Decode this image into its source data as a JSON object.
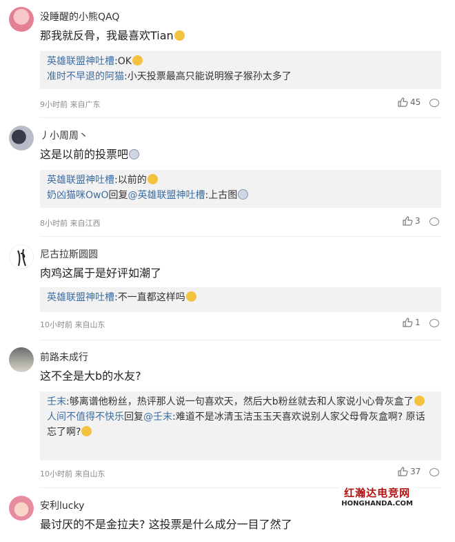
{
  "comments": [
    {
      "username": "没睡醒的小熊QAQ",
      "text": "那我就反骨，我最喜欢Tian",
      "replies": [
        {
          "author": "英雄联盟神吐槽",
          "content": ":OK"
        },
        {
          "author": "准时不早退的阿猫",
          "content": ":小天投票最高只能说明猴子猴孙太多了"
        }
      ],
      "meta": "9小时前 来自广东",
      "likes": "45"
    },
    {
      "username": "丿小周周丶",
      "text": "这是以前的投票吧",
      "replies": [
        {
          "author": "英雄联盟神吐槽",
          "content": ":以前的"
        },
        {
          "author": "奶凶猫咪OwO",
          "reply_word": "回复",
          "target": "@英雄联盟神吐槽",
          "content": ":上古图"
        }
      ],
      "meta": "8小时前 来自江西",
      "likes": "3"
    },
    {
      "username": "尼古拉斯圆圆",
      "text": "肉鸡这属于是好评如潮了",
      "replies": [
        {
          "author": "英雄联盟神吐槽",
          "content": ":不一直都这样吗"
        }
      ],
      "meta": "10小时前 来自山东",
      "likes": "1"
    },
    {
      "username": "前路未成行",
      "text": "这不全是大b的水友?",
      "replies": [
        {
          "author": "壬末",
          "content": ":够离谱他粉丝，热评那人说一句喜欢天，然后大b粉丝就去和人家说小心骨灰盒了"
        },
        {
          "author": "人间不值得不快乐",
          "reply_word": "回复",
          "target": "@壬末",
          "content": ":难道不是冰清玉洁玉玉天喜欢说别人家父母骨灰盒啊? 原话忘了啊?"
        }
      ],
      "meta": "10小时前 来自山东",
      "likes": "37"
    },
    {
      "username": "安利lucky",
      "text": "最讨厌的不是金拉夫? 这投票是什么成分一目了然了",
      "replies": [],
      "meta": "",
      "likes": ""
    }
  ],
  "watermark": {
    "line1": "红瀚达电竞网",
    "line2": "HONGHANDA.COM"
  },
  "colors": {
    "link": "#3c6ea3",
    "reply_bg": "#f2f2f2",
    "watermark_red": "#b01010"
  },
  "icons": {
    "like": "thumbs-up-icon",
    "comment": "comment-bubble-icon"
  }
}
